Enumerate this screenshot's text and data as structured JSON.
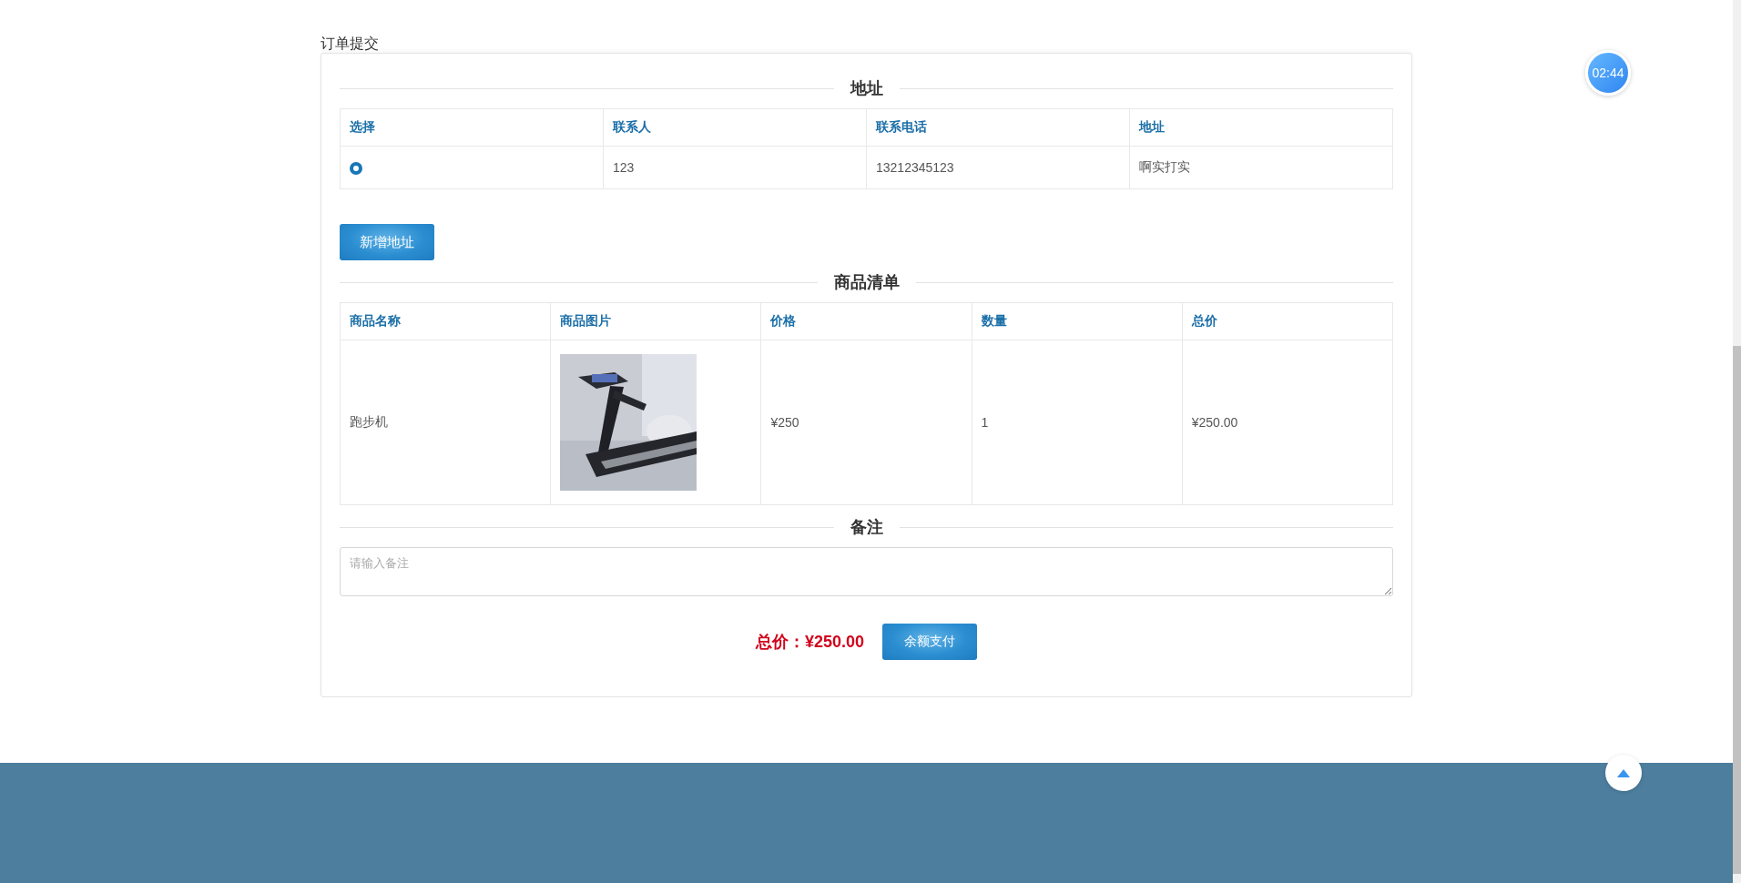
{
  "page_title": "订单提交",
  "address_section": {
    "heading": "地址",
    "columns": [
      "选择",
      "联系人",
      "联系电话",
      "地址"
    ],
    "rows": [
      {
        "selected": true,
        "contact": "123",
        "phone": "13212345123",
        "address": "啊实打实"
      }
    ],
    "add_button": "新增地址"
  },
  "items_section": {
    "heading": "商品清单",
    "columns": [
      "商品名称",
      "商品图片",
      "价格",
      "数量",
      "总价"
    ],
    "rows": [
      {
        "name": "跑步机",
        "price": "¥250",
        "quantity": "1",
        "total": "¥250.00"
      }
    ]
  },
  "note_section": {
    "heading": "备注",
    "placeholder": "请输入备注"
  },
  "total": {
    "label": "总价：",
    "amount": "¥250.00"
  },
  "pay_button": "余额支付",
  "timer": "02:44"
}
